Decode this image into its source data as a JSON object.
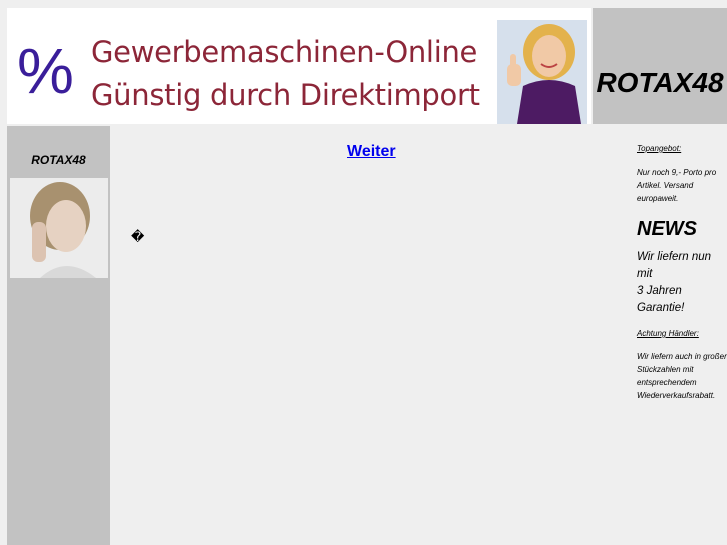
{
  "header": {
    "percent_sign": "%",
    "line1": "Gewerbemaschinen-Online",
    "line2": "Günstig durch Direktimport",
    "brand": "ROTAX48"
  },
  "sidebar_left": {
    "title": "ROTAX48"
  },
  "main": {
    "link_label": "Weiter",
    "replacement_char": "�"
  },
  "sidebar_right": {
    "top_offer_heading": "Topangebot:",
    "top_offer_text": "Nur noch 9,- Porto pro Artikel. Versand europaweit.",
    "news_heading": "NEWS",
    "news_text": "Wir liefern nun mit",
    "news_text2": "3 Jahren Garantie!",
    "dealer_heading": "Achtung Händler:",
    "dealer_text": "Wir liefern auch in großen Stückzahlen mit entsprechendem Wiederverkaufsrabatt."
  },
  "colors": {
    "header_red": "#8c2638",
    "percent_purple": "#3a1e9a",
    "sidebar_gray": "#c2c2c2",
    "link_blue": "#0000ee"
  }
}
